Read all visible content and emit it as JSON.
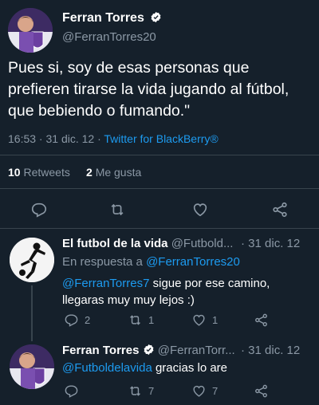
{
  "main_tweet": {
    "display_name": "Ferran Torres",
    "handle": "@FerranTorres20",
    "text": "Pues si, soy de esas personas que prefieren tirarse la vida jugando al fútbol, que bebiendo o fumando.\"",
    "time": "16:53 · 31 dic. 12 ·",
    "client": "Twitter for BlackBerry®",
    "retweets_count": "10",
    "retweets_label": "Retweets",
    "likes_count": "2",
    "likes_label": "Me gusta"
  },
  "reply_1": {
    "display_name": "El futbol de la vida",
    "handle": "@Futbold...",
    "date": "· 31 dic. 12",
    "reply_to_label": "En respuesta a",
    "reply_to_handle": "@FerranTorres20",
    "mention": "@FerranTorres7",
    "text_after_mention": " sigue por ese camino,",
    "text_line2": "llegaras muy muy lejos :)",
    "reply_count": "2",
    "retweet_count": "1",
    "like_count": "1"
  },
  "reply_2": {
    "display_name": "Ferran Torres",
    "handle": "@FerranTorr...",
    "date": "· 31 dic. 12",
    "mention": "@Futboldelavida",
    "text_after_mention": " gracias lo are",
    "retweet_count": "7",
    "like_count": "7"
  },
  "colors": {
    "background": "#15202b",
    "accent": "#1d9bf0",
    "muted": "#8b98a5",
    "divider": "#38444d"
  },
  "icons": [
    "verified-icon",
    "reply-icon",
    "retweet-icon",
    "like-icon",
    "share-icon"
  ]
}
